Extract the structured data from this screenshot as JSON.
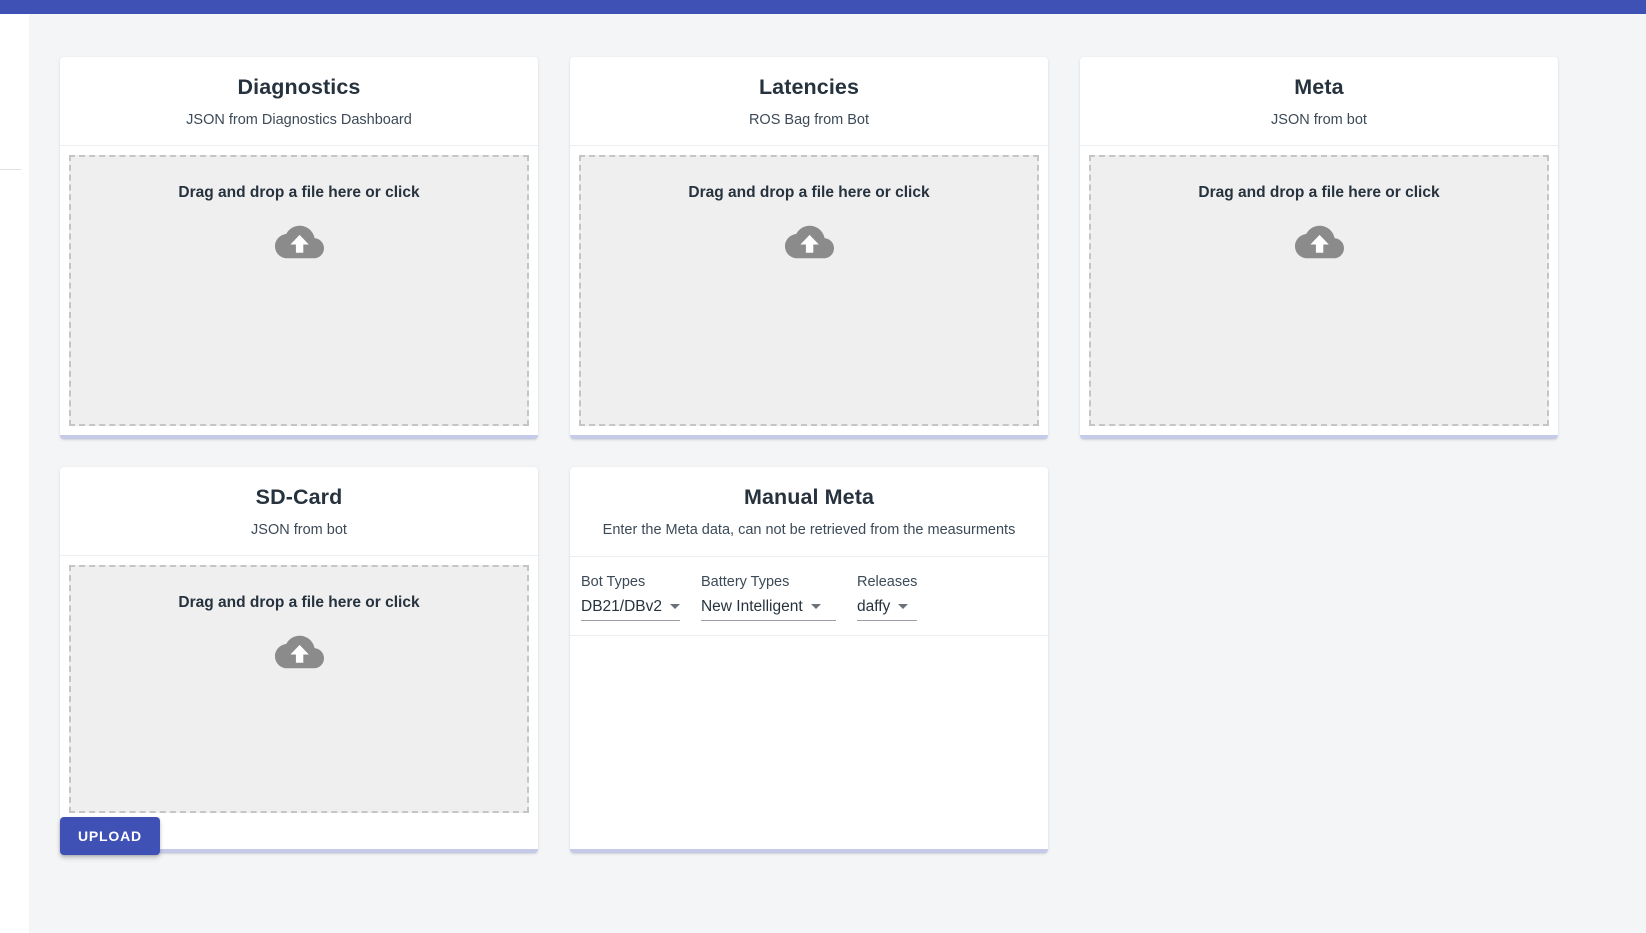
{
  "theme": {
    "primary_color": "#3f51b5",
    "card_accent_color": "#c5cae9",
    "page_background": "#f4f5f7",
    "dropzone_background": "#efeff0",
    "dropzone_border_color": "#c3c5c7"
  },
  "cards": [
    {
      "title": "Diagnostics",
      "subtitle": "JSON from Diagnostics Dashboard",
      "dropzone_text": "Drag and drop a file here or click",
      "dropzone_icon": "cloud-upload-icon"
    },
    {
      "title": "Latencies",
      "subtitle": "ROS Bag from Bot",
      "dropzone_text": "Drag and drop a file here or click",
      "dropzone_icon": "cloud-upload-icon"
    },
    {
      "title": "Meta",
      "subtitle": "JSON from bot",
      "dropzone_text": "Drag and drop a file here or click",
      "dropzone_icon": "cloud-upload-icon"
    },
    {
      "title": "SD-Card",
      "subtitle": "JSON from bot",
      "dropzone_text": "Drag and drop a file here or click",
      "dropzone_icon": "cloud-upload-icon"
    }
  ],
  "manual_meta": {
    "title": "Manual Meta",
    "subtitle": "Enter the Meta data, can not be retrieved from the measurments",
    "fields": [
      {
        "label": "Bot Types",
        "value": "DB21/DBv2",
        "icon": "chevron-down-icon"
      },
      {
        "label": "Battery Types",
        "value": "New Intelligent",
        "icon": "chevron-down-icon"
      },
      {
        "label": "Releases",
        "value": "daffy",
        "icon": "chevron-down-icon"
      }
    ]
  },
  "actions": {
    "upload_label": "UPLOAD"
  }
}
